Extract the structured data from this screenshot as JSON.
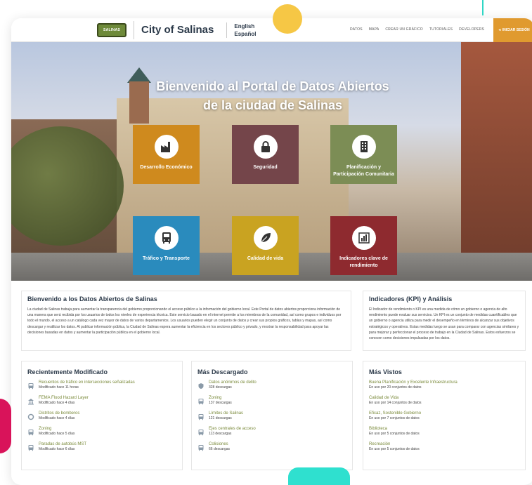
{
  "header": {
    "logo_text": "SALINAS",
    "title": "City of Salinas",
    "languages": [
      "English",
      "Español"
    ],
    "nav": [
      "DATOS",
      "MAPA",
      "CREAR UN GRÁFICO",
      "TUTORIALES",
      "DEVELOPERS"
    ],
    "signin": "◄ INICIAR SESIÓN"
  },
  "hero": {
    "title_line1": "Bienvenido al Portal de Datos Abiertos",
    "title_line2": "de la ciudad de Salinas",
    "tiles": [
      {
        "label": "Desarrollo Económico",
        "color": "#cf8a1e",
        "icon": "factory-icon"
      },
      {
        "label": "Seguridad",
        "color": "#74454a",
        "icon": "lock-icon"
      },
      {
        "label": "Planificación y Participación Comunitaria",
        "color": "#7c8d55",
        "icon": "building-icon"
      },
      {
        "label": "Tráfico y Transporte",
        "color": "#2a8bbd",
        "icon": "bus-icon"
      },
      {
        "label": "Calidad de vida",
        "color": "#c9a321",
        "icon": "leaf-icon"
      },
      {
        "label": "Indicadores clave de rendimiento",
        "color": "#8e2a2f",
        "icon": "bar-chart-icon"
      }
    ]
  },
  "welcome": {
    "title": "Bienvenido a los Datos Abiertos de Salinas",
    "body": "La ciudad de Salinas trabaja para aumentar la transparencia del gobierno proporcionando el acceso público a la información del gobierno local. Este Portal de datos abiertos proporciona información de una manera que será recibida por los usuarios de todos los niveles de experiencia técnica. Este servicio basado en el internet permite a los miembros de la comunidad, así como grupos e individuos por todo el mundo, el acceso a un catálogo cada vez mayor de datos de varios departamentos. Los usuarios pueden elegir un conjunto de datos y crear sus propios gráficos, tablas y mapas, así como descargar y reutilizar los datos. Al publicar información pública, la Ciudad de Salinas espera aumentar la eficiencia en los sectores público y privado, y mostrar la responsabilidad para apoyar las decisiones basadas en datos y aumentar la participación pública en el gobierno local."
  },
  "kpi": {
    "title": "Indicadores (KPI) y Análisis",
    "body": "El Indicador de rendimiento o KPI es una medida de cómo un gobierno o agencia de alto rendimiento puede evaluar sus servicios. Un KPI es un conjunto de medidas cuantificables que un gobierno o agencia utiliza para medir el desempeño en términos de alcanzar sus objetivos estratégicos y operativos. Estas medidas luego se usan para comparar con agencias similares y para mejorar y perfeccionar el proceso de trabajo en la Ciudad de Salinas. Estos esfuerzos se conocen como decisiones impulsadas por los datos."
  },
  "recent": {
    "title": "Recientemente Modificado",
    "items": [
      {
        "title": "Recuentos de tráfico en intersecciones señalizadas",
        "sub": "Modificado hace 11 horas",
        "icon": "bus-icon"
      },
      {
        "title": "FEMA Flood Hazard Layer",
        "sub": "Modificado hace 4 días",
        "icon": "government-building-icon"
      },
      {
        "title": "Distritos de bomberos",
        "sub": "Modificado hace 4 días",
        "icon": "lifebuoy-icon"
      },
      {
        "title": "Zoning",
        "sub": "Modificado hace 5 días",
        "icon": "bus-icon"
      },
      {
        "title": "Paradas de autobús MST",
        "sub": "Modificado hace 6 días",
        "icon": "bus-icon"
      }
    ]
  },
  "downloaded": {
    "title": "Más Descargado",
    "items": [
      {
        "title": "Datos anónimos de delito",
        "sub": "328 descargas",
        "icon": "shield-icon"
      },
      {
        "title": "Zoning",
        "sub": "137 descargas",
        "icon": "bus-icon"
      },
      {
        "title": "Límites de Salinas",
        "sub": "121 descargas",
        "icon": "bus-icon"
      },
      {
        "title": "Ejes centrales de acceso",
        "sub": "113 descargas",
        "icon": "bus-icon"
      },
      {
        "title": "Colisiones",
        "sub": "66 descargas",
        "icon": "bus-icon"
      }
    ]
  },
  "viewed": {
    "title": "Más Vistos",
    "items": [
      {
        "title": "Buena Planificación y Excelente Infraestructura",
        "sub": "En uso por 20 conjuntos de datos"
      },
      {
        "title": "Calidad de Vida",
        "sub": "En uso por 14 conjuntos de datos"
      },
      {
        "title": "Eficaz, Sostenible Gobierno",
        "sub": "En uso por 7 conjuntos de datos"
      },
      {
        "title": "Biblioteca",
        "sub": "En uso por 5 conjuntos de datos"
      },
      {
        "title": "Recreación",
        "sub": "En uso por 5 conjuntos de datos"
      }
    ]
  },
  "colors": {
    "accent": "#e09a2f",
    "link": "#7a8a3a",
    "heading": "#2c3a4a"
  }
}
